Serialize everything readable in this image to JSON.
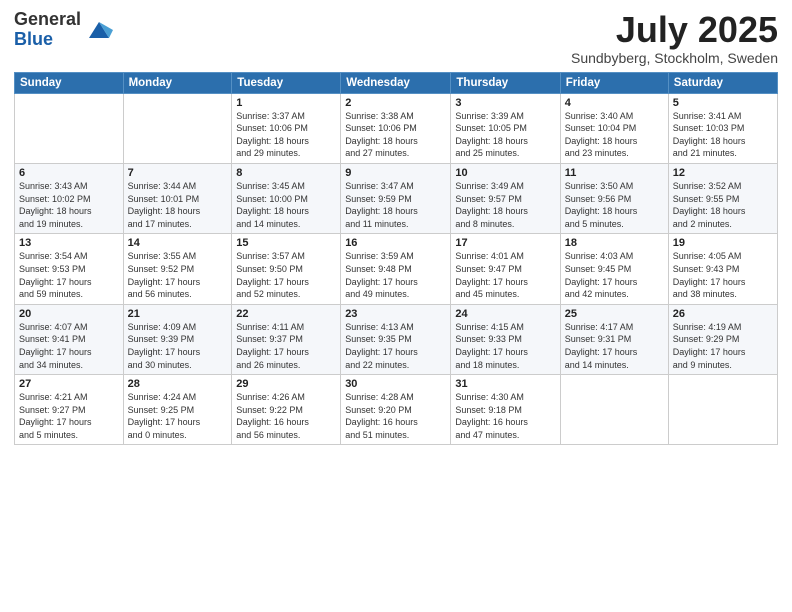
{
  "logo": {
    "general": "General",
    "blue": "Blue"
  },
  "title": "July 2025",
  "subtitle": "Sundbyberg, Stockholm, Sweden",
  "days_of_week": [
    "Sunday",
    "Monday",
    "Tuesday",
    "Wednesday",
    "Thursday",
    "Friday",
    "Saturday"
  ],
  "weeks": [
    [
      {
        "day": "",
        "info": ""
      },
      {
        "day": "",
        "info": ""
      },
      {
        "day": "1",
        "info": "Sunrise: 3:37 AM\nSunset: 10:06 PM\nDaylight: 18 hours\nand 29 minutes."
      },
      {
        "day": "2",
        "info": "Sunrise: 3:38 AM\nSunset: 10:06 PM\nDaylight: 18 hours\nand 27 minutes."
      },
      {
        "day": "3",
        "info": "Sunrise: 3:39 AM\nSunset: 10:05 PM\nDaylight: 18 hours\nand 25 minutes."
      },
      {
        "day": "4",
        "info": "Sunrise: 3:40 AM\nSunset: 10:04 PM\nDaylight: 18 hours\nand 23 minutes."
      },
      {
        "day": "5",
        "info": "Sunrise: 3:41 AM\nSunset: 10:03 PM\nDaylight: 18 hours\nand 21 minutes."
      }
    ],
    [
      {
        "day": "6",
        "info": "Sunrise: 3:43 AM\nSunset: 10:02 PM\nDaylight: 18 hours\nand 19 minutes."
      },
      {
        "day": "7",
        "info": "Sunrise: 3:44 AM\nSunset: 10:01 PM\nDaylight: 18 hours\nand 17 minutes."
      },
      {
        "day": "8",
        "info": "Sunrise: 3:45 AM\nSunset: 10:00 PM\nDaylight: 18 hours\nand 14 minutes."
      },
      {
        "day": "9",
        "info": "Sunrise: 3:47 AM\nSunset: 9:59 PM\nDaylight: 18 hours\nand 11 minutes."
      },
      {
        "day": "10",
        "info": "Sunrise: 3:49 AM\nSunset: 9:57 PM\nDaylight: 18 hours\nand 8 minutes."
      },
      {
        "day": "11",
        "info": "Sunrise: 3:50 AM\nSunset: 9:56 PM\nDaylight: 18 hours\nand 5 minutes."
      },
      {
        "day": "12",
        "info": "Sunrise: 3:52 AM\nSunset: 9:55 PM\nDaylight: 18 hours\nand 2 minutes."
      }
    ],
    [
      {
        "day": "13",
        "info": "Sunrise: 3:54 AM\nSunset: 9:53 PM\nDaylight: 17 hours\nand 59 minutes."
      },
      {
        "day": "14",
        "info": "Sunrise: 3:55 AM\nSunset: 9:52 PM\nDaylight: 17 hours\nand 56 minutes."
      },
      {
        "day": "15",
        "info": "Sunrise: 3:57 AM\nSunset: 9:50 PM\nDaylight: 17 hours\nand 52 minutes."
      },
      {
        "day": "16",
        "info": "Sunrise: 3:59 AM\nSunset: 9:48 PM\nDaylight: 17 hours\nand 49 minutes."
      },
      {
        "day": "17",
        "info": "Sunrise: 4:01 AM\nSunset: 9:47 PM\nDaylight: 17 hours\nand 45 minutes."
      },
      {
        "day": "18",
        "info": "Sunrise: 4:03 AM\nSunset: 9:45 PM\nDaylight: 17 hours\nand 42 minutes."
      },
      {
        "day": "19",
        "info": "Sunrise: 4:05 AM\nSunset: 9:43 PM\nDaylight: 17 hours\nand 38 minutes."
      }
    ],
    [
      {
        "day": "20",
        "info": "Sunrise: 4:07 AM\nSunset: 9:41 PM\nDaylight: 17 hours\nand 34 minutes."
      },
      {
        "day": "21",
        "info": "Sunrise: 4:09 AM\nSunset: 9:39 PM\nDaylight: 17 hours\nand 30 minutes."
      },
      {
        "day": "22",
        "info": "Sunrise: 4:11 AM\nSunset: 9:37 PM\nDaylight: 17 hours\nand 26 minutes."
      },
      {
        "day": "23",
        "info": "Sunrise: 4:13 AM\nSunset: 9:35 PM\nDaylight: 17 hours\nand 22 minutes."
      },
      {
        "day": "24",
        "info": "Sunrise: 4:15 AM\nSunset: 9:33 PM\nDaylight: 17 hours\nand 18 minutes."
      },
      {
        "day": "25",
        "info": "Sunrise: 4:17 AM\nSunset: 9:31 PM\nDaylight: 17 hours\nand 14 minutes."
      },
      {
        "day": "26",
        "info": "Sunrise: 4:19 AM\nSunset: 9:29 PM\nDaylight: 17 hours\nand 9 minutes."
      }
    ],
    [
      {
        "day": "27",
        "info": "Sunrise: 4:21 AM\nSunset: 9:27 PM\nDaylight: 17 hours\nand 5 minutes."
      },
      {
        "day": "28",
        "info": "Sunrise: 4:24 AM\nSunset: 9:25 PM\nDaylight: 17 hours\nand 0 minutes."
      },
      {
        "day": "29",
        "info": "Sunrise: 4:26 AM\nSunset: 9:22 PM\nDaylight: 16 hours\nand 56 minutes."
      },
      {
        "day": "30",
        "info": "Sunrise: 4:28 AM\nSunset: 9:20 PM\nDaylight: 16 hours\nand 51 minutes."
      },
      {
        "day": "31",
        "info": "Sunrise: 4:30 AM\nSunset: 9:18 PM\nDaylight: 16 hours\nand 47 minutes."
      },
      {
        "day": "",
        "info": ""
      },
      {
        "day": "",
        "info": ""
      }
    ]
  ]
}
